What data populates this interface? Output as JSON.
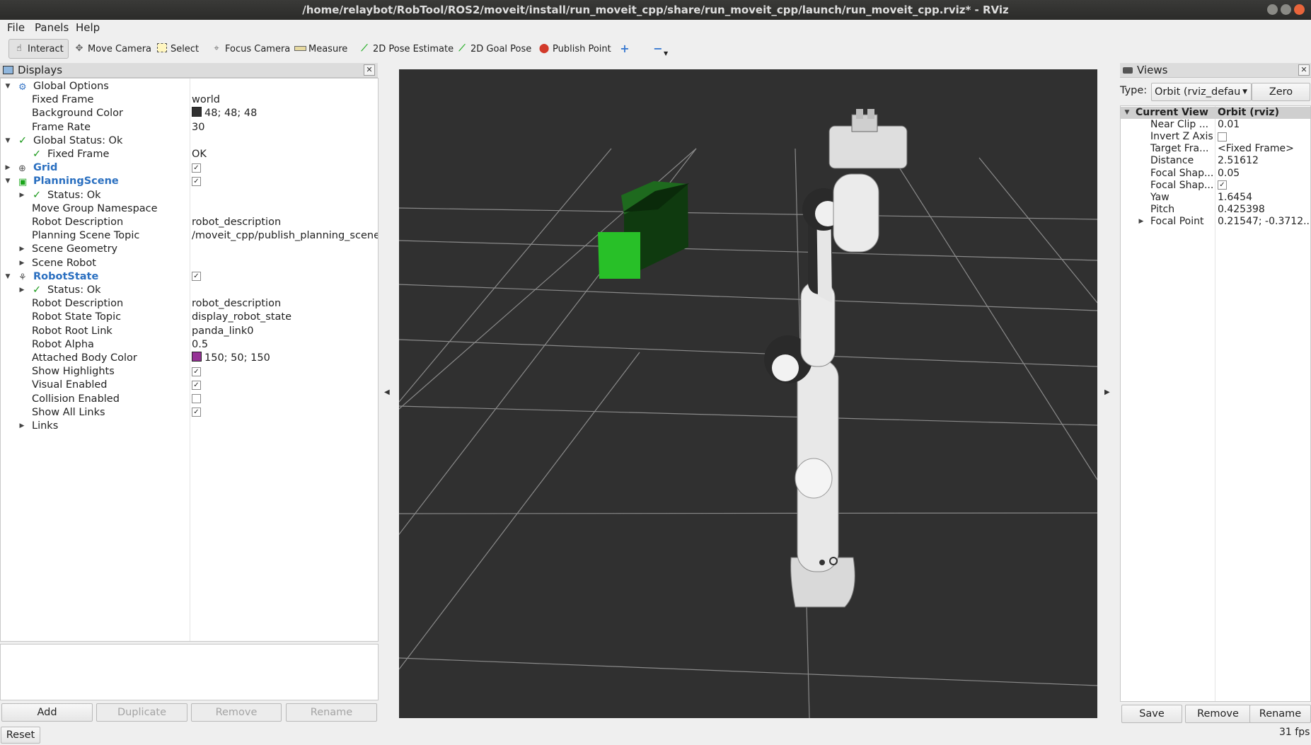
{
  "window": {
    "title": "/home/relaybot/RobTool/ROS2/moveit/install/run_moveit_cpp/share/run_moveit_cpp/launch/run_moveit_cpp.rviz* - RViz"
  },
  "menu": {
    "file": "File",
    "panels": "Panels",
    "help": "Help"
  },
  "toolbar": {
    "interact": "Interact",
    "move_camera": "Move Camera",
    "select": "Select",
    "focus_camera": "Focus Camera",
    "measure": "Measure",
    "pose_estimate": "2D Pose Estimate",
    "goal_pose": "2D Goal Pose",
    "publish_point": "Publish Point",
    "add_tool": "+",
    "remove_tool": "−"
  },
  "displays": {
    "title": "Displays",
    "rows": [
      {
        "label": "Global Options",
        "value": ""
      },
      {
        "label": "Fixed Frame",
        "value": "world"
      },
      {
        "label": "Background Color",
        "value": "48; 48; 48"
      },
      {
        "label": "Frame Rate",
        "value": "30"
      },
      {
        "label": "Global Status: Ok",
        "value": ""
      },
      {
        "label": "Fixed Frame",
        "value": "OK"
      },
      {
        "label": "Grid",
        "value": ""
      },
      {
        "label": "PlanningScene",
        "value": ""
      },
      {
        "label": "Status: Ok",
        "value": ""
      },
      {
        "label": "Move Group Namespace",
        "value": ""
      },
      {
        "label": "Robot Description",
        "value": "robot_description"
      },
      {
        "label": "Planning Scene Topic",
        "value": "/moveit_cpp/publish_planning_scene"
      },
      {
        "label": "Scene Geometry",
        "value": ""
      },
      {
        "label": "Scene Robot",
        "value": ""
      },
      {
        "label": "RobotState",
        "value": ""
      },
      {
        "label": "Status: Ok",
        "value": ""
      },
      {
        "label": "Robot Description",
        "value": "robot_description"
      },
      {
        "label": "Robot State Topic",
        "value": "display_robot_state"
      },
      {
        "label": "Robot Root Link",
        "value": "panda_link0"
      },
      {
        "label": "Robot Alpha",
        "value": "0.5"
      },
      {
        "label": "Attached Body Color",
        "value": "150; 50; 150"
      },
      {
        "label": "Show Highlights",
        "value": ""
      },
      {
        "label": "Visual Enabled",
        "value": ""
      },
      {
        "label": "Collision Enabled",
        "value": ""
      },
      {
        "label": "Show All Links",
        "value": ""
      },
      {
        "label": "Links",
        "value": ""
      }
    ],
    "checks": {
      "grid": true,
      "planning_scene": true,
      "robot_state": true,
      "show_highlights": true,
      "visual_enabled": true,
      "collision_enabled": false,
      "show_all_links": true
    },
    "background_color": "#303030",
    "attached_body_color": "#963296",
    "buttons": {
      "add": "Add",
      "duplicate": "Duplicate",
      "remove": "Remove",
      "rename": "Rename"
    }
  },
  "views": {
    "title": "Views",
    "type_label": "Type:",
    "type_value": "Orbit (rviz_defau",
    "zero": "Zero",
    "rows": [
      {
        "label": "Current View",
        "value": "Orbit (rviz)"
      },
      {
        "label": "Near Clip ...",
        "value": "0.01"
      },
      {
        "label": "Invert Z Axis",
        "value": ""
      },
      {
        "label": "Target Fra...",
        "value": "<Fixed Frame>"
      },
      {
        "label": "Distance",
        "value": "2.51612"
      },
      {
        "label": "Focal Shap...",
        "value": "0.05"
      },
      {
        "label": "Focal Shap...",
        "value": ""
      },
      {
        "label": "Yaw",
        "value": "1.6454"
      },
      {
        "label": "Pitch",
        "value": "0.425398"
      },
      {
        "label": "Focal Point",
        "value": "0.21547; -0.3712..."
      }
    ],
    "checks": {
      "invert_z": false,
      "focal_shape_fixed": true
    },
    "buttons": {
      "save": "Save",
      "remove": "Remove",
      "rename": "Rename"
    }
  },
  "status": {
    "reset": "Reset",
    "fps": "31 fps"
  }
}
